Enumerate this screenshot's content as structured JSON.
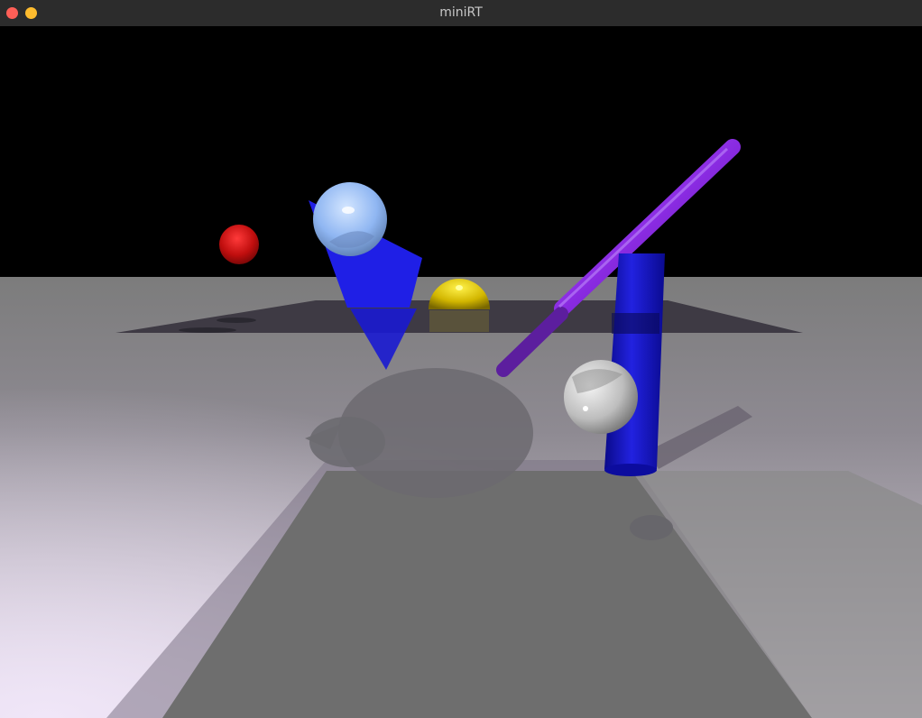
{
  "window": {
    "title": "miniRT",
    "controls": {
      "close_color": "#ff5f57",
      "minimize_color": "#febc2e"
    }
  },
  "scene": {
    "background": "#000000",
    "floor_colors": {
      "near_left": "#ece2f4",
      "far": "#7a7a7a",
      "shadow": "#6a6a6a"
    },
    "objects": [
      {
        "name": "red-sphere",
        "color": "#cc1010"
      },
      {
        "name": "light-blue-sphere",
        "color": "#8fb6f2"
      },
      {
        "name": "blue-triangle",
        "color": "#1f1fe6"
      },
      {
        "name": "yellow-sphere",
        "color": "#d8c000"
      },
      {
        "name": "purple-cylinder",
        "color": "#8a2be2"
      },
      {
        "name": "blue-cylinder",
        "color": "#1414c8"
      },
      {
        "name": "white-sphere",
        "color": "#d0d0d0"
      }
    ]
  }
}
